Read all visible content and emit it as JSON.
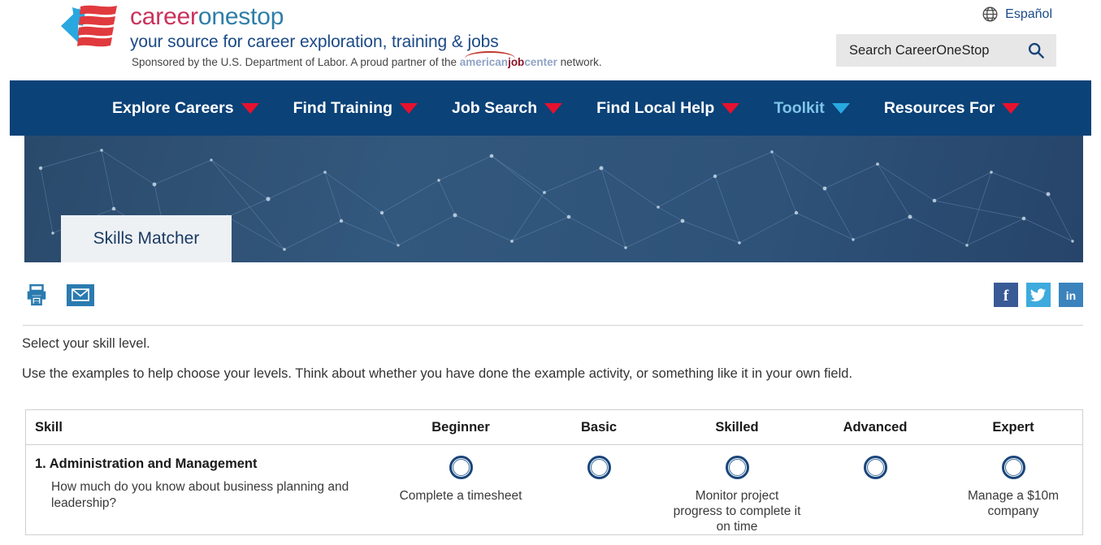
{
  "header": {
    "brand_part1": "career",
    "brand_part2": "onestop",
    "tagline": "your source for career exploration, training & jobs",
    "sponsor_prefix": "Sponsored by the U.S. Department of Labor. A proud partner of the ",
    "ajc_american": "american",
    "ajc_job": "job",
    "ajc_center": "center",
    "sponsor_suffix": " network.",
    "espanol_label": "Español",
    "globe_icon": "globe-icon",
    "search_placeholder": "Search CareerOneStop",
    "search_icon": "search-icon",
    "logo_icon": "careeronestop-flag-logo"
  },
  "nav": {
    "items": [
      {
        "label": "Explore Careers",
        "active": false,
        "caret_icon": "chevron-down-icon"
      },
      {
        "label": "Find Training",
        "active": false,
        "caret_icon": "chevron-down-icon"
      },
      {
        "label": "Job Search",
        "active": false,
        "caret_icon": "chevron-down-icon"
      },
      {
        "label": "Find Local Help",
        "active": false,
        "caret_icon": "chevron-down-icon"
      },
      {
        "label": "Toolkit",
        "active": true,
        "caret_icon": "chevron-down-icon"
      },
      {
        "label": "Resources For",
        "active": false,
        "caret_icon": "chevron-down-icon"
      }
    ]
  },
  "hero": {
    "title": "Skills Matcher"
  },
  "share": {
    "print_icon": "printer-icon",
    "email_icon": "envelope-icon",
    "facebook_icon": "facebook-icon",
    "twitter_icon": "twitter-icon",
    "linkedin_icon": "linkedin-icon",
    "facebook_glyph": "f",
    "linkedin_glyph": "in"
  },
  "instructions": {
    "line1": "Select your skill level.",
    "line2": "Use the examples to help choose your levels. Think about whether you have done the example activity, or something like it in your own field."
  },
  "table": {
    "headers": [
      "Skill",
      "Beginner",
      "Basic",
      "Skilled",
      "Advanced",
      "Expert"
    ],
    "rows": [
      {
        "number_and_title": "1. Administration and Management",
        "description": "How much do you know about business planning and leadership?",
        "levels": [
          {
            "level": "Beginner",
            "example": "Complete a timesheet",
            "selected": false
          },
          {
            "level": "Basic",
            "example": "",
            "selected": false
          },
          {
            "level": "Skilled",
            "example": "Monitor project progress to complete it on time",
            "selected": false
          },
          {
            "level": "Advanced",
            "example": "",
            "selected": false
          },
          {
            "level": "Expert",
            "example": "Manage a $10m company",
            "selected": false
          }
        ]
      }
    ]
  },
  "colors": {
    "nav_blue": "#0b4278",
    "brand_red": "#c9325c",
    "brand_blue": "#2e7ea8",
    "caret_red": "#e8112d",
    "caret_active": "#29a8e0",
    "radio_blue": "#19457a",
    "hero_blue": "#2e5278"
  }
}
